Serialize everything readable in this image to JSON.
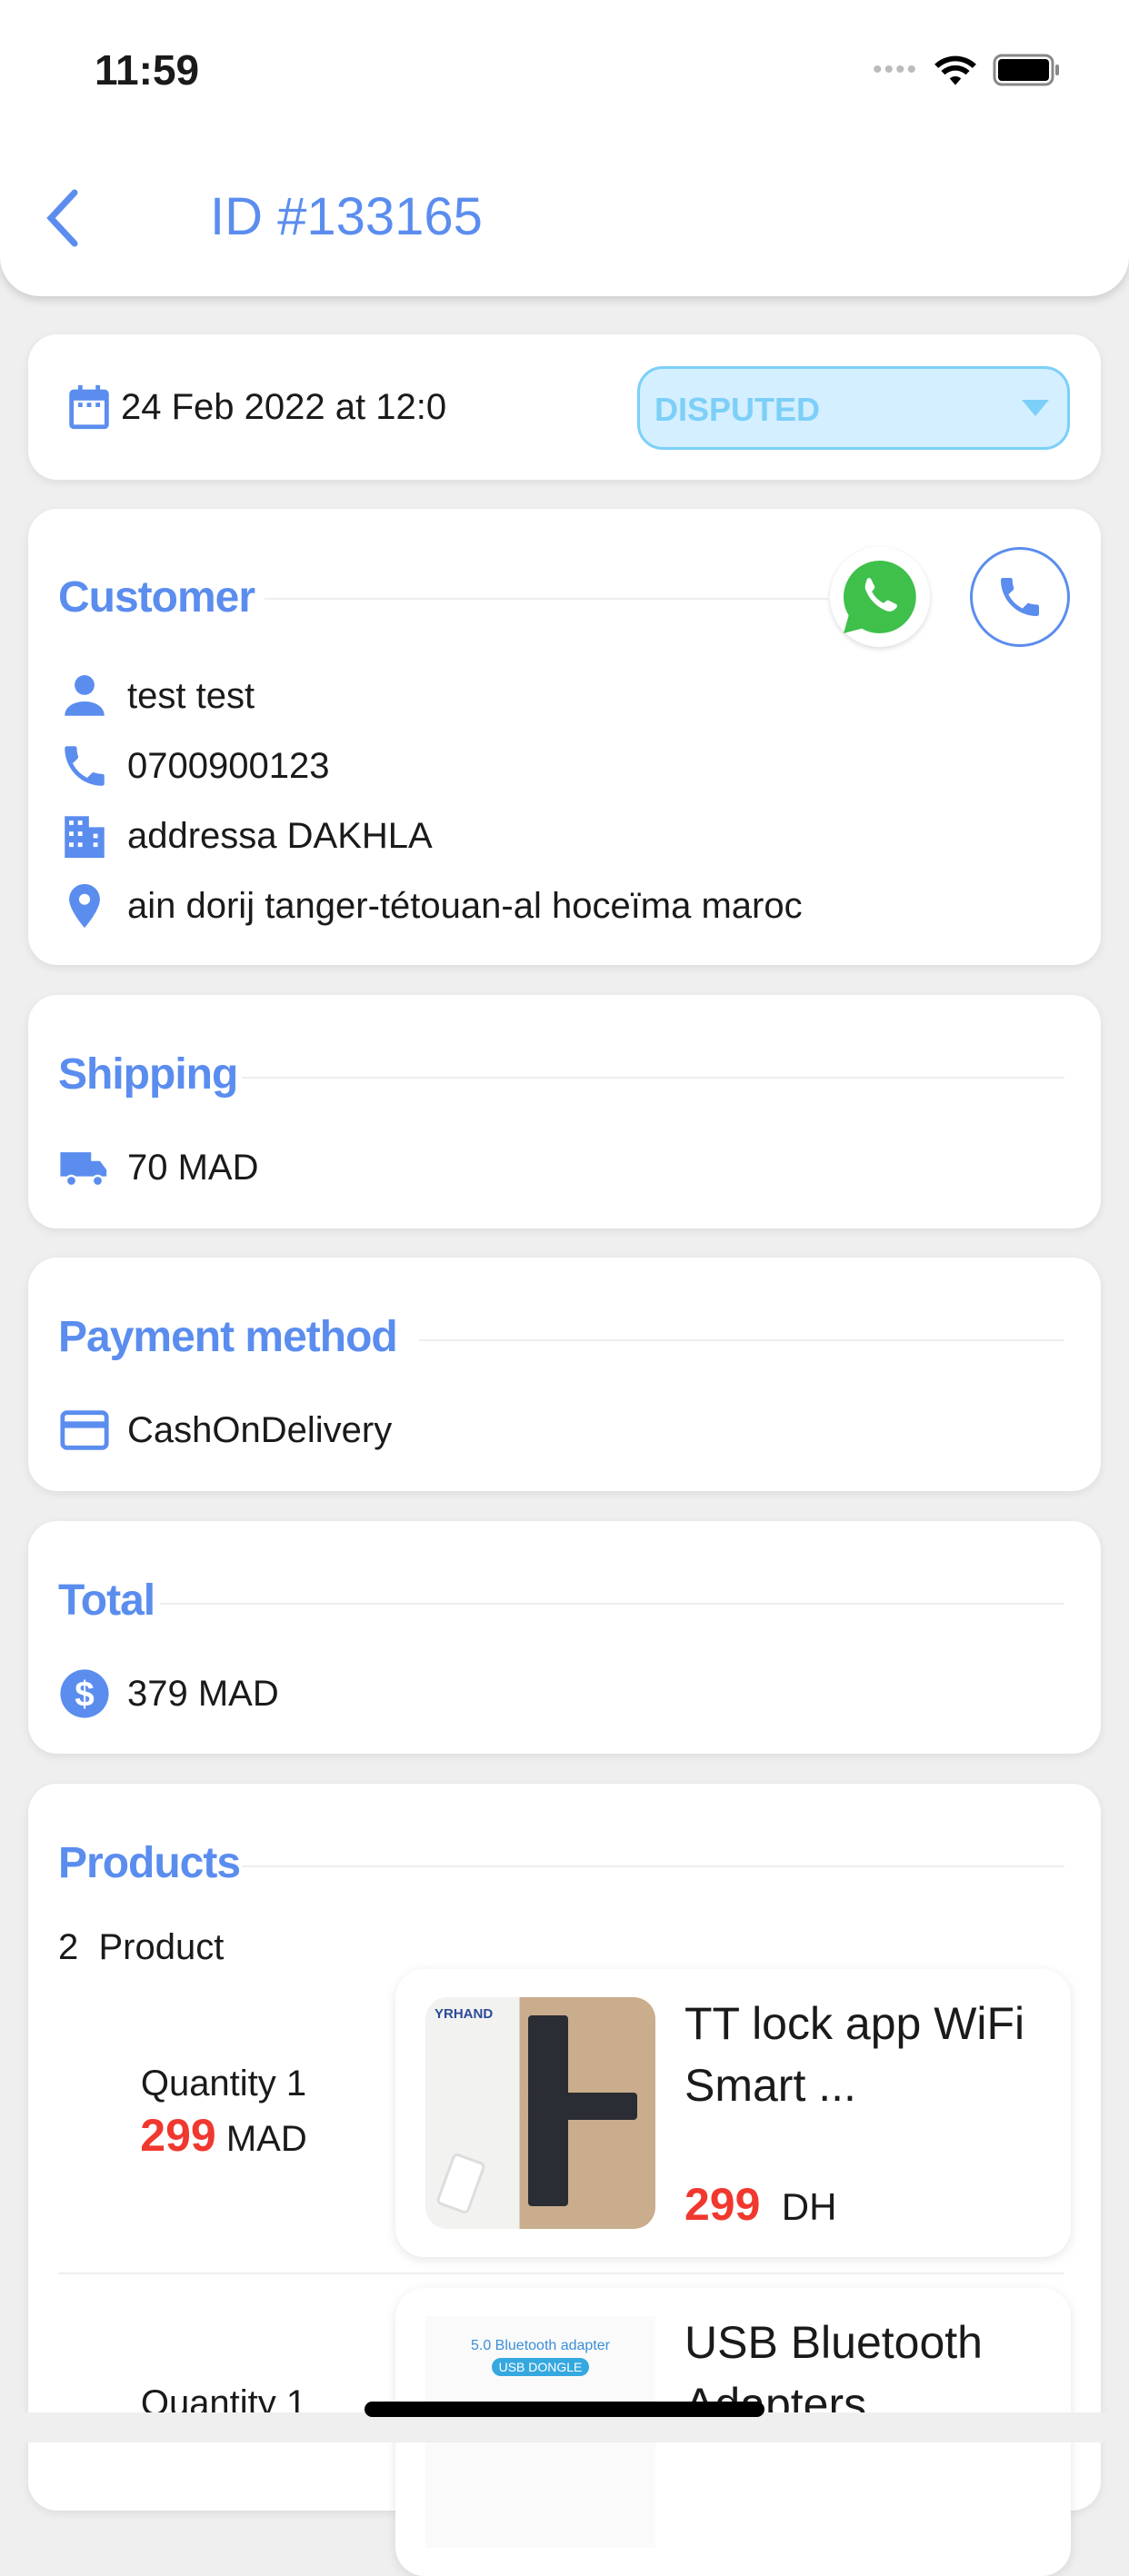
{
  "status_bar": {
    "time": "11:59"
  },
  "header": {
    "title": "ID #133165"
  },
  "order": {
    "date": "24 Feb 2022 at 12:0",
    "status": "DISPUTED"
  },
  "customer": {
    "title": "Customer",
    "name": "test test",
    "phone": "0700900123",
    "address": "addressa DAKHLA",
    "location": "ain dorij tanger-tétouan-al hoceïma maroc"
  },
  "shipping": {
    "title": "Shipping",
    "value": "70 MAD"
  },
  "payment": {
    "title": "Payment method",
    "value": "CashOnDelivery"
  },
  "total": {
    "title": "Total",
    "value": "379 MAD"
  },
  "products": {
    "title": "Products",
    "count_label": "2  Product",
    "items": [
      {
        "quantity": "Quantity 1",
        "price": "299",
        "currency": "MAD",
        "name_line1": "TT lock app WiFi",
        "name_line2": "Smart ...",
        "card_price": "299",
        "card_currency": "DH",
        "image_brand": "YRHAND"
      },
      {
        "quantity": "Quantity 1",
        "name_line1": "USB Bluetooth",
        "name_line2": "Adapters ...",
        "image_caption": "5.0 Bluetooth adapter",
        "image_badge": "USB DONGLE"
      }
    ]
  },
  "colors": {
    "accent": "#5b8def",
    "price": "#f0382f",
    "status_bg": "#d4efff",
    "status_text": "#7ccff8",
    "whatsapp": "#3ec04b"
  }
}
